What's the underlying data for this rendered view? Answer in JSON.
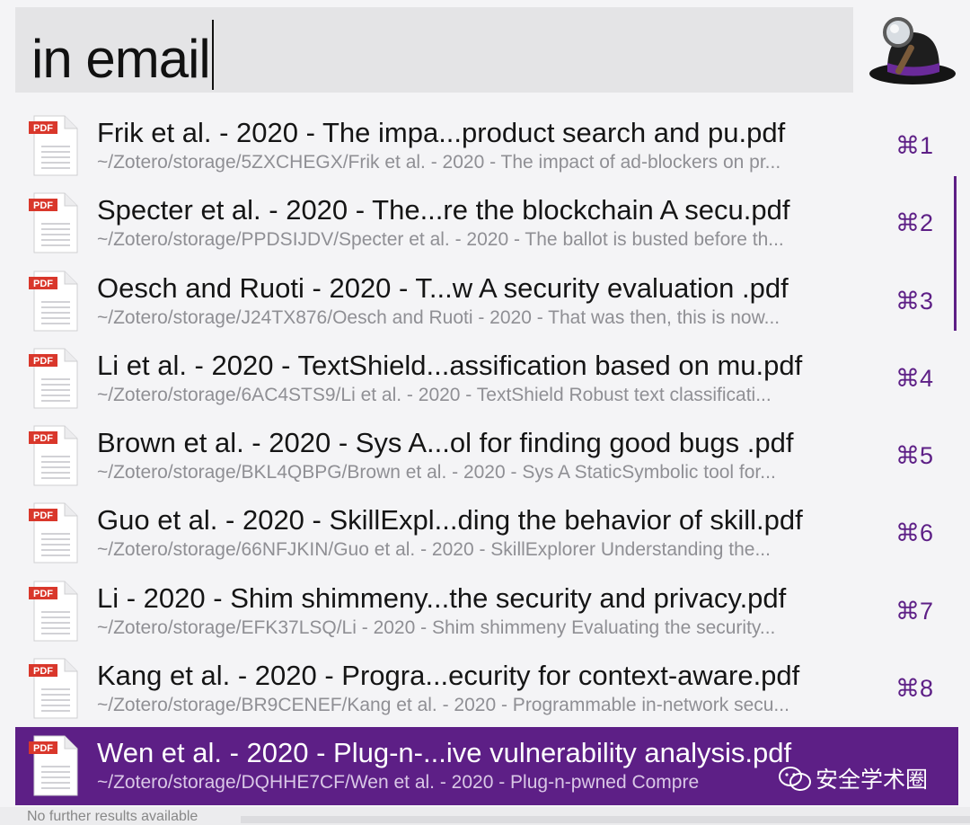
{
  "search": {
    "query": "in email"
  },
  "results": [
    {
      "badge": "PDF",
      "title": "Frik et al. - 2020 - The impa...product search and pu.pdf",
      "subtitle": "~/Zotero/storage/5ZXCHEGX/Frik et al. - 2020 - The impact of ad-blockers on pr...",
      "shortcut": "⌘1"
    },
    {
      "badge": "PDF",
      "title": "Specter et al. - 2020 - The...re the blockchain A secu.pdf",
      "subtitle": "~/Zotero/storage/PPDSIJDV/Specter et al. - 2020 - The ballot is busted before th...",
      "shortcut": "⌘2"
    },
    {
      "badge": "PDF",
      "title": "Oesch and Ruoti - 2020 - T...w A security evaluation .pdf",
      "subtitle": "~/Zotero/storage/J24TX876/Oesch and Ruoti - 2020 - That was then, this is now...",
      "shortcut": "⌘3"
    },
    {
      "badge": "PDF",
      "title": "Li et al. - 2020 - TextShield...assification based on mu.pdf",
      "subtitle": "~/Zotero/storage/6AC4STS9/Li et al. - 2020 - TextShield Robust text classificati...",
      "shortcut": "⌘4"
    },
    {
      "badge": "PDF",
      "title": "Brown et al. - 2020 - Sys A...ol for finding good bugs .pdf",
      "subtitle": "~/Zotero/storage/BKL4QBPG/Brown et al. - 2020 - Sys A StaticSymbolic tool for...",
      "shortcut": "⌘5"
    },
    {
      "badge": "PDF",
      "title": "Guo et al. - 2020 - SkillExpl...ding the behavior of skill.pdf",
      "subtitle": "~/Zotero/storage/66NFJKIN/Guo et al. - 2020 - SkillExplorer Understanding the...",
      "shortcut": "⌘6"
    },
    {
      "badge": "PDF",
      "title": "Li - 2020 - Shim shimmeny...the security and privacy.pdf",
      "subtitle": "~/Zotero/storage/EFK37LSQ/Li - 2020 - Shim shimmeny Evaluating the security...",
      "shortcut": "⌘7"
    },
    {
      "badge": "PDF",
      "title": "Kang et al. - 2020 - Progra...ecurity for context-aware.pdf",
      "subtitle": "~/Zotero/storage/BR9CENEF/Kang et al. - 2020 - Programmable in-network secu...",
      "shortcut": "⌘8"
    },
    {
      "badge": "PDF",
      "title": "Wen et al. - 2020 - Plug-n-...ive vulnerability analysis.pdf",
      "subtitle": "~/Zotero/storage/DQHHE7CF/Wen et al. - 2020 - Plug-n-pwned Compre",
      "shortcut": "",
      "selected": true
    }
  ],
  "watermark": {
    "text": "安全学术圈"
  },
  "footer": {
    "text": "No further results available"
  },
  "colors": {
    "accent": "#5d1f86",
    "pdf_badge": "#d9372b",
    "selected_text": "#ffffff"
  },
  "icons": {
    "app": "alfred-hat-icon",
    "file": "pdf-file-icon",
    "watermark": "wechat-icon"
  }
}
